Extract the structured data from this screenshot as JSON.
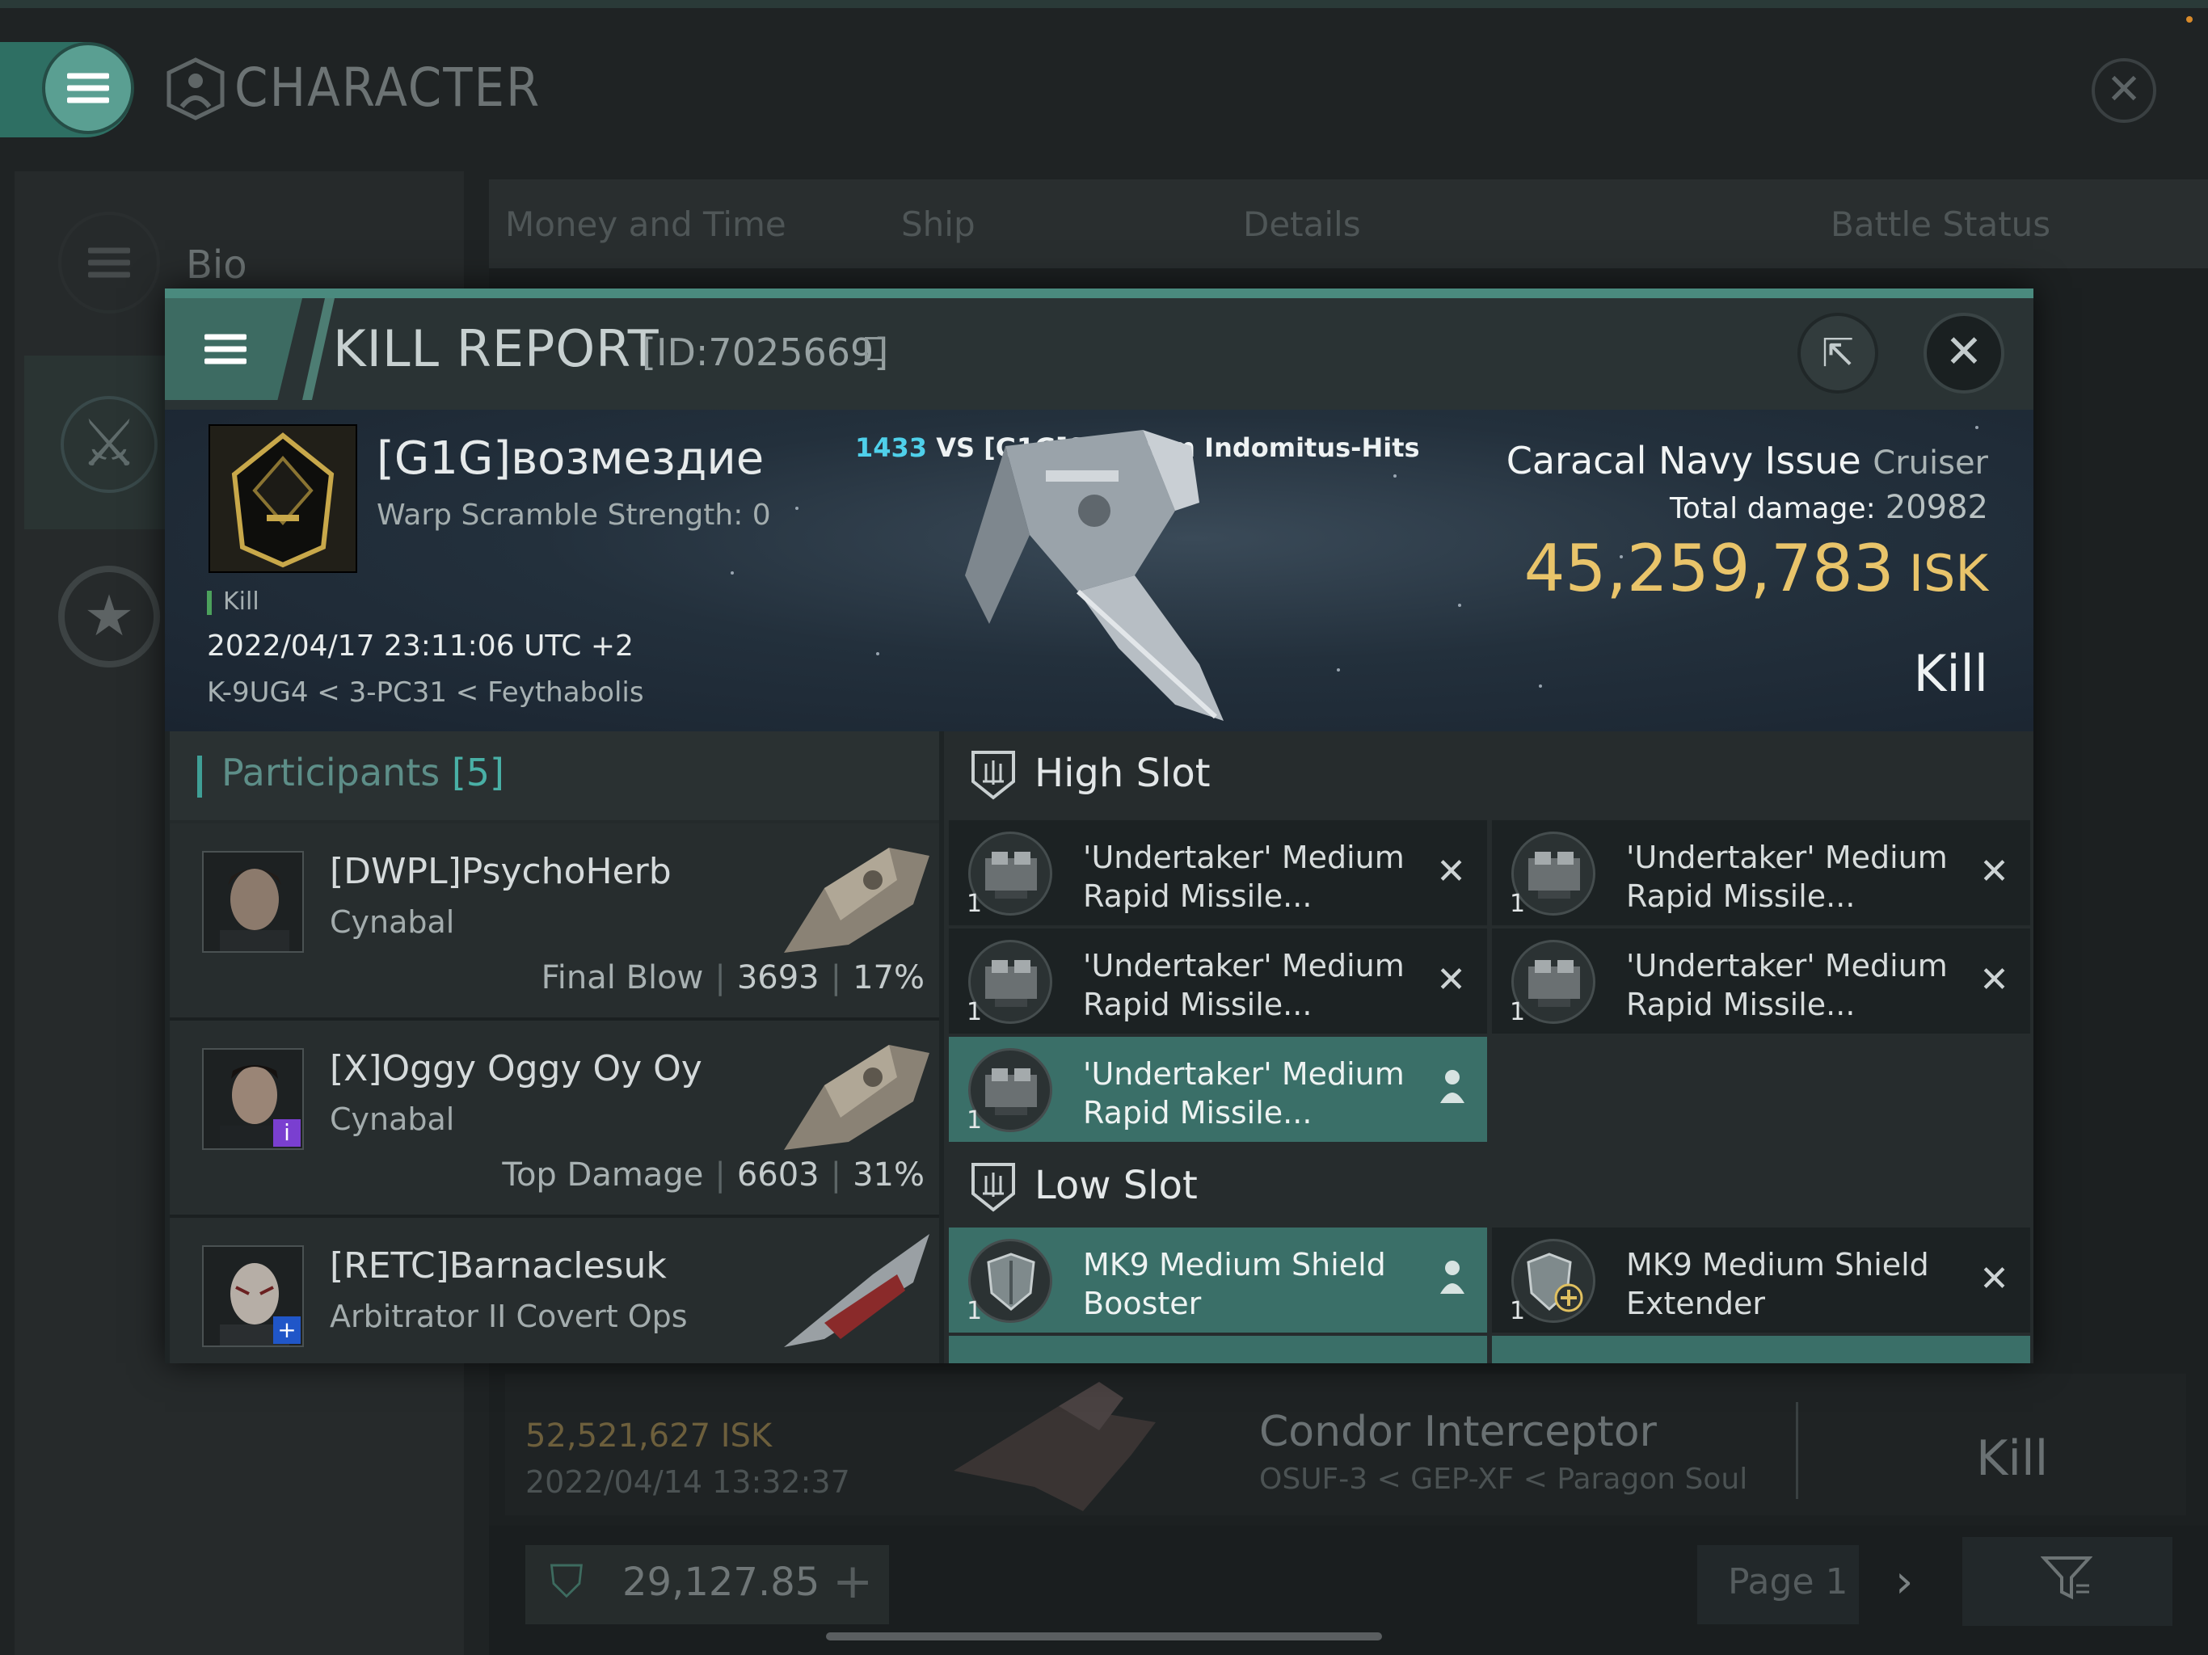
{
  "background": {
    "title": "CHARACTER",
    "sidebar": {
      "bio_label": "Bio"
    },
    "tabs": [
      "Money and Time",
      "Ship",
      "Details",
      "Battle Status"
    ],
    "row": {
      "isk": "52,521,627 ISK",
      "date": "2022/04/14  13:32:37",
      "ship": "Condor Interceptor",
      "location": "OSUF-3 < GEP-XF < Paragon Soul",
      "status": "Kill"
    },
    "wallet": "29,127.85",
    "page_label": "Page 1"
  },
  "kill_report": {
    "title": "KILL REPORT",
    "id": "[ID:7025669]",
    "victim": {
      "name": "[G1G]возмездие",
      "warp_scramble": "Warp Scramble Strength: 0",
      "tag": "Kill",
      "datetime": "2022/04/17 23:11:06 UTC +2",
      "location": "K-9UG4 < 3-PC31 < Feythabolis"
    },
    "vs": {
      "number": "1433",
      "text": "VS [G1G]Sanctum Indomitus-Hits"
    },
    "ship": {
      "name": "Caracal Navy Issue",
      "class": "Cruiser",
      "total_damage_label": "Total damage:",
      "total_damage": "20982",
      "isk_value": "45,259,783",
      "isk_unit": "ISK",
      "status": "Kill"
    },
    "participants": {
      "title": "Participants",
      "count": "[5]",
      "items": [
        {
          "name": "[DWPL]PsychoHerb",
          "ship": "Cynabal",
          "label": "Final Blow",
          "damage": "3693",
          "percent": "17%"
        },
        {
          "name": "[X]Oggy Oggy Oy Oy",
          "ship": "Cynabal",
          "label": "Top Damage",
          "damage": "6603",
          "percent": "31%"
        },
        {
          "name": "[RETC]Barnaclesuk",
          "ship": "Arbitrator II Covert Ops"
        }
      ]
    },
    "high_slot": {
      "label": "High Slot",
      "modules": [
        {
          "qty": "1",
          "line1": "'Undertaker' Medium",
          "line2": "Rapid Missile..."
        },
        {
          "qty": "1",
          "line1": "'Undertaker' Medium",
          "line2": "Rapid Missile..."
        },
        {
          "qty": "1",
          "line1": "'Undertaker' Medium",
          "line2": "Rapid Missile..."
        },
        {
          "qty": "1",
          "line1": "'Undertaker' Medium",
          "line2": "Rapid Missile..."
        },
        {
          "qty": "1",
          "line1": "'Undertaker' Medium",
          "line2": "Rapid Missile..."
        }
      ]
    },
    "low_slot": {
      "label": "Low Slot",
      "modules": [
        {
          "qty": "1",
          "line1": "MK9 Medium Shield",
          "line2": "Booster"
        },
        {
          "qty": "1",
          "line1": "MK9 Medium Shield",
          "line2": "Extender"
        }
      ]
    }
  },
  "colors": {
    "accent": "#4a8a7e",
    "isk_gold": "#e9c46a",
    "vs_cyan": "#4fd0ea",
    "dropped_highlight": "#3a6f68"
  }
}
